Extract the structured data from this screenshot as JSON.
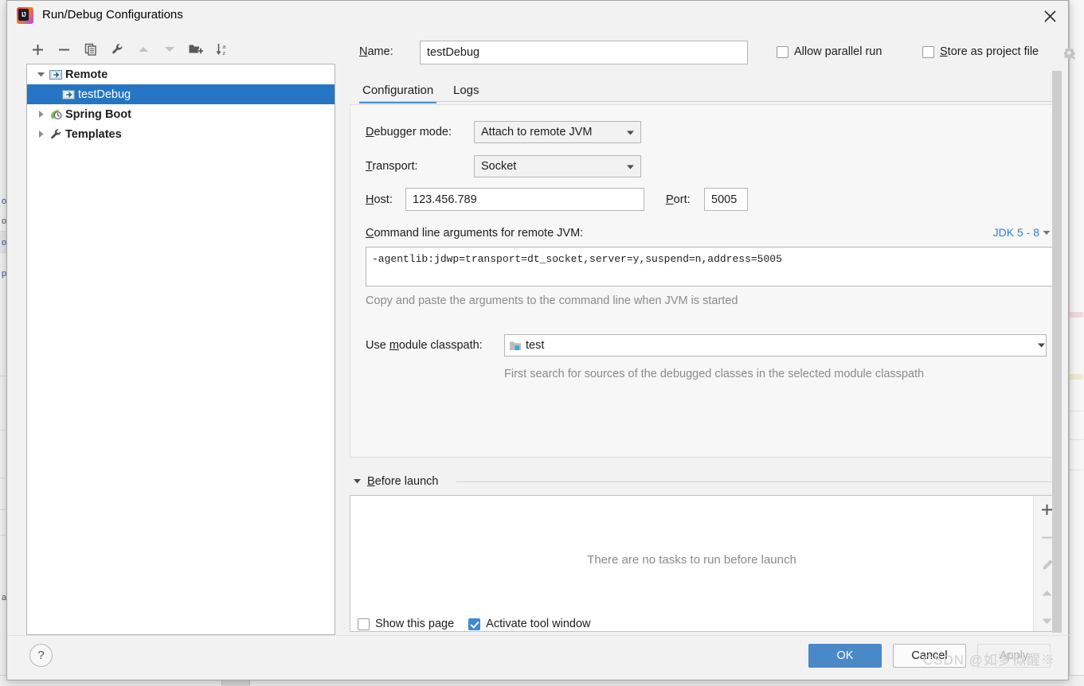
{
  "window": {
    "title": "Run/Debug Configurations",
    "app_icon": "intellij-idea-icon",
    "app_icon_letters": "IJ",
    "close_label": "×"
  },
  "toolbar": {
    "buttons": [
      {
        "name": "add-configuration-button",
        "icon": "plus-icon",
        "enabled": true
      },
      {
        "name": "remove-configuration-button",
        "icon": "minus-icon",
        "enabled": true
      },
      {
        "name": "copy-configuration-button",
        "icon": "copy-icon",
        "enabled": true
      },
      {
        "name": "edit-templates-button",
        "icon": "wrench-icon",
        "enabled": true
      },
      {
        "name": "move-up-button",
        "icon": "arrow-up-icon",
        "enabled": false
      },
      {
        "name": "move-down-button",
        "icon": "arrow-down-icon",
        "enabled": false
      },
      {
        "name": "new-folder-button",
        "icon": "folder-add-icon",
        "enabled": true
      },
      {
        "name": "sort-alphabetically-button",
        "icon": "sort-az-icon",
        "enabled": true
      }
    ]
  },
  "tree": {
    "items": [
      {
        "label": "Remote",
        "icon": "remote-config-icon",
        "expanded": true,
        "bold": true,
        "selected": false,
        "child": false
      },
      {
        "label": "testDebug",
        "icon": "remote-config-icon",
        "expanded": null,
        "bold": false,
        "selected": true,
        "child": true
      },
      {
        "label": "Spring Boot",
        "icon": "spring-boot-icon",
        "expanded": false,
        "bold": true,
        "selected": false,
        "child": false
      },
      {
        "label": "Templates",
        "icon": "wrench-icon",
        "expanded": false,
        "bold": true,
        "selected": false,
        "child": false
      }
    ]
  },
  "form": {
    "name_label": "Name:",
    "name_label_mnemonic": "N",
    "name_value": "testDebug",
    "allow_parallel_run": {
      "label": "Allow parallel run",
      "checked": false
    },
    "store_as_project_file": {
      "label": "Store as project file",
      "checked": false
    },
    "gear_icon": "gear-icon",
    "tabs": [
      {
        "label": "Configuration",
        "active": true
      },
      {
        "label": "Logs",
        "active": false
      }
    ],
    "debugger_mode": {
      "label": "Debugger mode:",
      "mnemonic": "D",
      "value": "Attach to remote JVM"
    },
    "transport": {
      "label": "Transport:",
      "mnemonic": "T",
      "value": "Socket"
    },
    "host": {
      "label": "Host:",
      "mnemonic": "H",
      "value": "123.456.789"
    },
    "port": {
      "label": "Port:",
      "mnemonic": "P",
      "value": "5005"
    },
    "command_line": {
      "label": "Command line arguments for remote JVM:",
      "mnemonic": "C",
      "value": "-agentlib:jdwp=transport=dt_socket,server=y,suspend=n,address=5005",
      "hint": "Copy and paste the arguments to the command line when JVM is started",
      "jdk_selector": "JDK 5 - 8"
    },
    "module_classpath": {
      "label": "Use module classpath:",
      "mnemonic": "m",
      "value": "test",
      "icon": "module-icon",
      "hint": "First search for sources of the debugged classes in the selected module classpath"
    }
  },
  "before_launch": {
    "title": "Before launch",
    "mnemonic": "B",
    "empty_text": "There are no tasks to run before launch",
    "buttons": [
      {
        "name": "add-task-button",
        "icon": "plus-icon",
        "enabled": true
      },
      {
        "name": "remove-task-button",
        "icon": "minus-icon",
        "enabled": false
      },
      {
        "name": "edit-task-button",
        "icon": "pencil-icon",
        "enabled": false
      },
      {
        "name": "move-task-up-button",
        "icon": "arrow-up-icon",
        "enabled": false
      },
      {
        "name": "move-task-down-button",
        "icon": "arrow-down-icon",
        "enabled": false
      }
    ]
  },
  "bottom": {
    "show_this_page": {
      "label": "Show this page",
      "checked": false
    },
    "activate_tool_window": {
      "label": "Activate tool window",
      "checked": true
    },
    "ok_label": "OK",
    "cancel_label": "Cancel",
    "apply_label": "Apply",
    "apply_enabled": false,
    "help_label": "?"
  },
  "watermark": "CSDN @如梦似醒※",
  "background_ide": {
    "tab_fragments": [
      "ol",
      "o",
      "o",
      "p",
      "a"
    ]
  },
  "colors": {
    "selection_blue": "#2675c4",
    "accent_blue": "#4a88c7",
    "link_blue": "#2f7fd0",
    "checkbox_checked": "#3d8ad6",
    "dialog_bg": "#f2f2f2",
    "hint_gray": "#8a8a8a"
  }
}
